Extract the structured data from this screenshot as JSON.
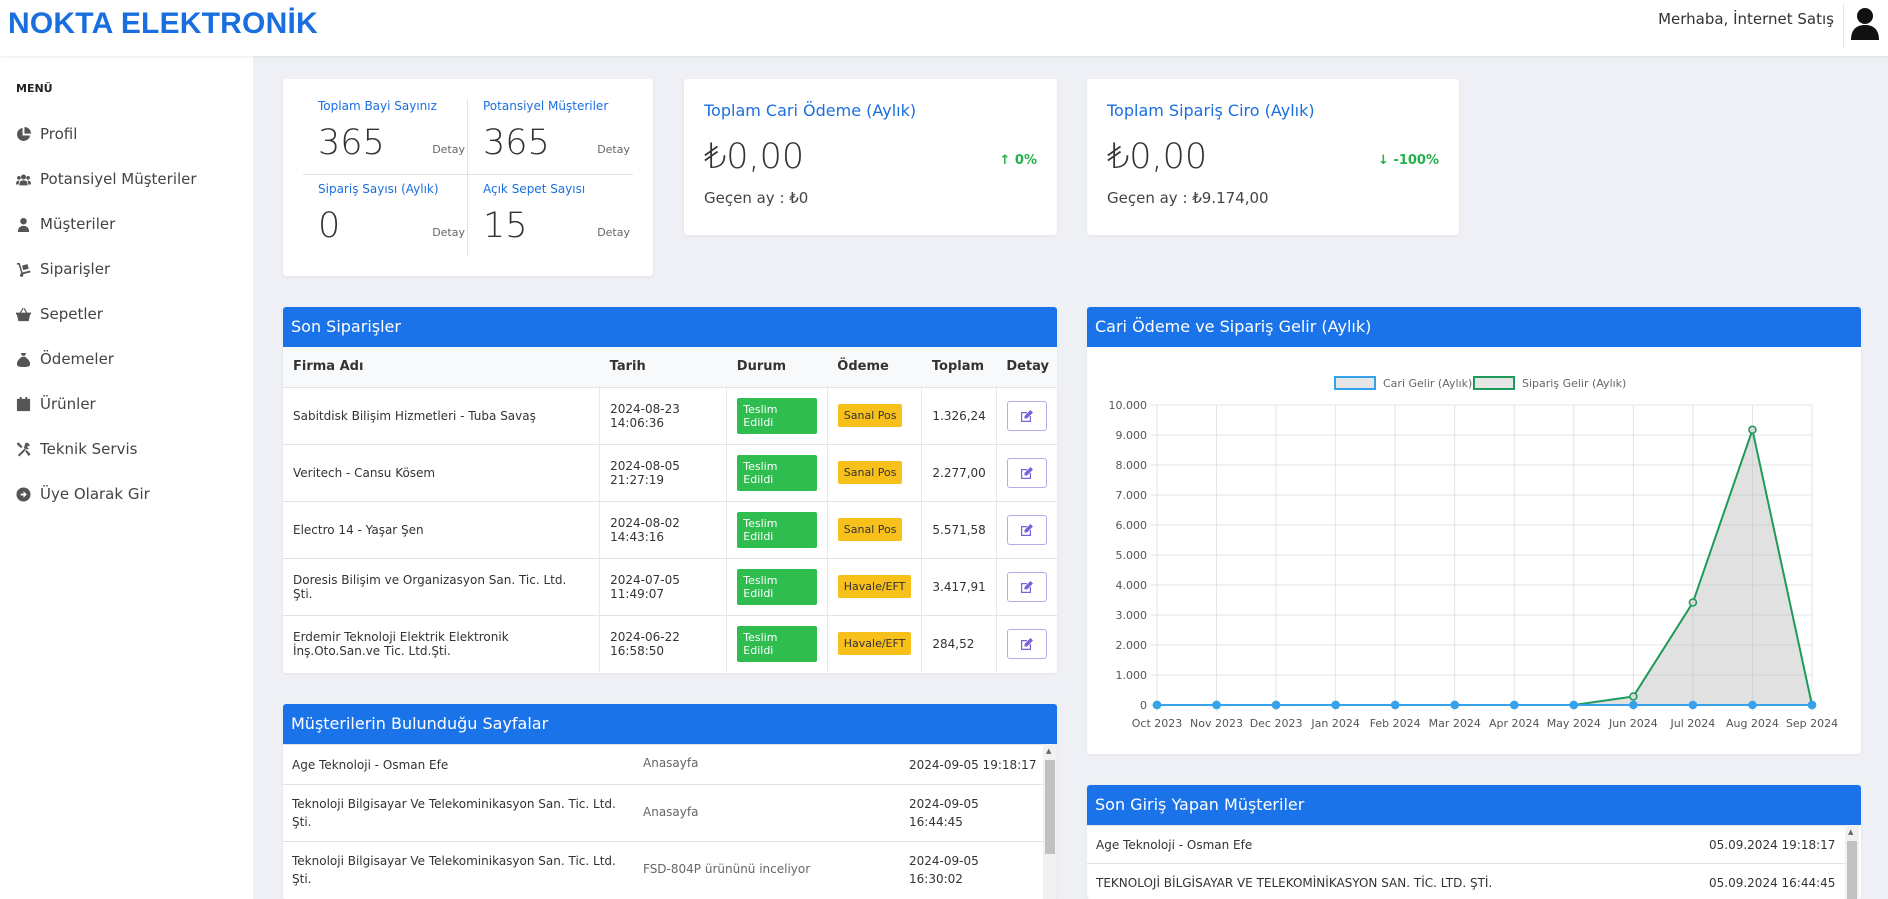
{
  "header": {
    "logo": "NOKTA ELEKTRONİK",
    "greeting": "Merhaba, İnternet Satış",
    "user_icon": "user-icon"
  },
  "sidebar": {
    "menu_title": "MENÜ",
    "items": [
      {
        "label": "Profil",
        "icon": "pie-chart-icon"
      },
      {
        "label": "Potansiyel Müşteriler",
        "icon": "users-icon"
      },
      {
        "label": "Müşteriler",
        "icon": "user-icon"
      },
      {
        "label": "Siparişler",
        "icon": "dolly-icon"
      },
      {
        "label": "Sepetler",
        "icon": "basket-icon"
      },
      {
        "label": "Ödemeler",
        "icon": "money-bag-icon"
      },
      {
        "label": "Ürünler",
        "icon": "calendar-icon"
      },
      {
        "label": "Teknik Servis",
        "icon": "tools-icon"
      },
      {
        "label": "Üye Olarak Gir",
        "icon": "arrow-circle-icon"
      }
    ]
  },
  "stats": {
    "cells": [
      {
        "label": "Toplam Bayi Sayınız",
        "value": "365",
        "link": "Detay"
      },
      {
        "label": "Potansiyel Müşteriler",
        "value": "365",
        "link": "Detay"
      },
      {
        "label": "Sipariş Sayısı (Aylık)",
        "value": "0",
        "link": "Detay"
      },
      {
        "label": "Açık Sepet Sayısı",
        "value": "15",
        "link": "Detay"
      }
    ]
  },
  "kpi": {
    "cari": {
      "title": "Toplam Cari Ödeme (Aylık)",
      "value": "₺0,00",
      "change": "0%",
      "change_direction": "up",
      "prev": "Geçen ay : ₺0"
    },
    "ciro": {
      "title": "Toplam Sipariş Ciro (Aylık)",
      "value": "₺0,00",
      "change": "-100%",
      "change_direction": "down",
      "prev": "Geçen ay : ₺9.174,00"
    },
    "change_color": "#22b04b"
  },
  "orders": {
    "title": "Son Siparişler",
    "columns": [
      "Firma Adı",
      "Tarih",
      "Durum",
      "Ödeme",
      "Toplam",
      "Detay"
    ],
    "rows": [
      {
        "firm": "Sabitdisk Bilişim Hizmetleri - Tuba Savaş",
        "date": "2024-08-23",
        "time": "14:06:36",
        "status": "Teslim Edildi",
        "payment": "Sanal Pos",
        "total": "1.326,24"
      },
      {
        "firm": "Veritech - Cansu Kösem",
        "date": "2024-08-05",
        "time": "21:27:19",
        "status": "Teslim Edildi",
        "payment": "Sanal Pos",
        "total": "2.277,00"
      },
      {
        "firm": "Electro 14 - Yaşar Şen",
        "date": "2024-08-02",
        "time": "14:43:16",
        "status": "Teslim Edildi",
        "payment": "Sanal Pos",
        "total": "5.571,58"
      },
      {
        "firm": "Doresis Bilişim ve Organizasyon San. Tic. Ltd. Şti.",
        "date": "2024-07-05",
        "time": "11:49:07",
        "status": "Teslim Edildi",
        "payment": "Havale/EFT",
        "total": "3.417,91"
      },
      {
        "firm": "Erdemir Teknoloji Elektrik Elektronik İnş.Oto.San.ve Tic. Ltd.Şti.",
        "date": "2024-06-22",
        "time": "16:58:50",
        "status": "Teslim Edildi",
        "payment": "Havale/EFT",
        "total": "284,52"
      }
    ],
    "status_color": "#2ebd4e",
    "payment_color": "#f8c01a"
  },
  "pages": {
    "title": "Müşterilerin Bulunduğu Sayfalar",
    "rows": [
      {
        "firm": "Age Teknoloji - Osman Efe",
        "page": "Anasayfa",
        "datetime": "2024-09-05 19:18:17"
      },
      {
        "firm": "Teknoloji Bilgisayar Ve Telekominikasyon San. Tic. Ltd. Şti.",
        "page": "Anasayfa",
        "date": "2024-09-05",
        "time": "16:44:45"
      },
      {
        "firm": "Teknoloji Bilgisayar Ve Telekominikasyon San. Tic. Ltd. Şti.",
        "page": "FSD-804P ürününü inceliyor",
        "date": "2024-09-05",
        "time": "16:30:02"
      }
    ]
  },
  "chart_panel": {
    "title": "Cari Ödeme ve Sipariş Gelir (Aylık)"
  },
  "chart_data": {
    "type": "line",
    "title": "",
    "categories": [
      "Oct 2023",
      "Nov 2023",
      "Dec 2023",
      "Jan 2024",
      "Feb 2024",
      "Mar 2024",
      "Apr 2024",
      "May 2024",
      "Jun 2024",
      "Jul 2024",
      "Aug 2024",
      "Sep 2024"
    ],
    "series": [
      {
        "name": "Cari Gelir (Aylık)",
        "values": [
          0,
          0,
          0,
          0,
          0,
          0,
          0,
          0,
          0,
          0,
          0,
          0
        ],
        "color": "#36a2eb"
      },
      {
        "name": "Sipariş Gelir (Aylık)",
        "values": [
          0,
          0,
          0,
          0,
          0,
          0,
          0,
          0,
          284.52,
          3417.91,
          9174,
          0
        ],
        "color": "#1e9a5b",
        "fill": true
      }
    ],
    "ylim": [
      0,
      10000
    ],
    "yticks": [
      "0",
      "1.000",
      "2.000",
      "3.000",
      "4.000",
      "5.000",
      "6.000",
      "7.000",
      "8.000",
      "9.000",
      "10.000"
    ],
    "legend_position": "top",
    "grid": true
  },
  "logins": {
    "title": "Son Giriş Yapan Müşteriler",
    "rows": [
      {
        "firm": "Age Teknoloji - Osman Efe",
        "datetime": "05.09.2024 19:18:17"
      },
      {
        "firm": "TEKNOLOJİ BİLGİSAYAR VE TELEKOMİNİKASYON SAN. TİC. LTD. ŞTİ.",
        "datetime": "05.09.2024 16:44:45"
      }
    ]
  }
}
